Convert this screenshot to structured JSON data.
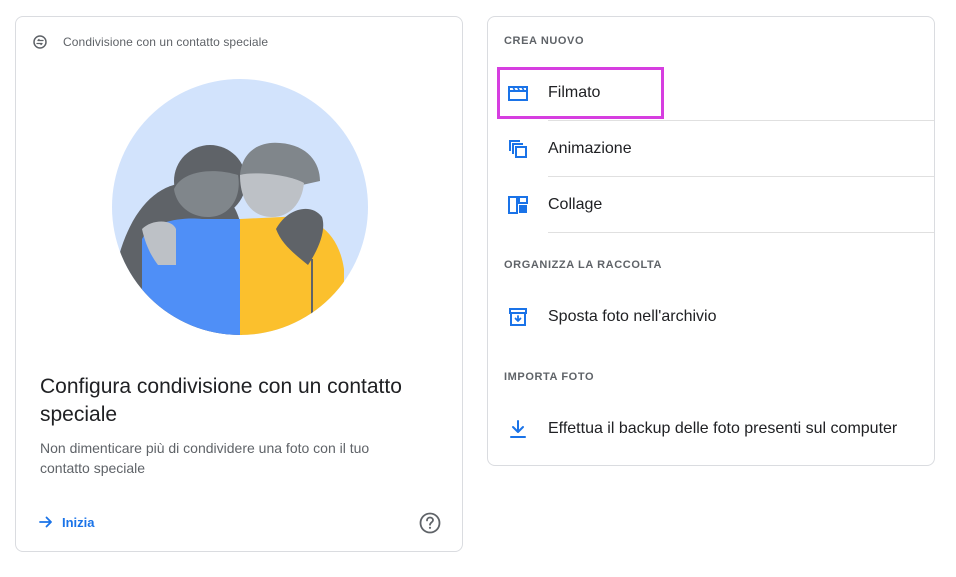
{
  "left_card": {
    "header_icon": "partner-sharing-icon",
    "header_text": "Condivisione con un contatto speciale",
    "title": "Configura condivisione con un contatto speciale",
    "description": "Non dimenticare più di condividere una foto con il tuo contatto speciale",
    "action_label": "Inizia",
    "action_icon": "arrow-forward-icon",
    "help_icon": "help-icon"
  },
  "right_card": {
    "sections": [
      {
        "label": "CREA NUOVO",
        "items": [
          {
            "label": "Filmato",
            "icon": "movie-icon",
            "highlighted": true
          },
          {
            "label": "Animazione",
            "icon": "animation-icon"
          },
          {
            "label": "Collage",
            "icon": "collage-icon"
          }
        ]
      },
      {
        "label": "ORGANIZZA LA RACCOLTA",
        "items": [
          {
            "label": "Sposta foto nell'archivio",
            "icon": "archive-icon"
          }
        ]
      },
      {
        "label": "IMPORTA FOTO",
        "items": [
          {
            "label": "Effettua il backup delle foto presenti sul computer",
            "icon": "download-icon"
          }
        ]
      }
    ]
  },
  "colors": {
    "accent_blue": "#1a73e8",
    "highlight_magenta": "#d63ee0",
    "illustration_bg": "#d2e3fc",
    "illustration_blue": "#4f8ff7",
    "illustration_yellow": "#fbc02d"
  }
}
